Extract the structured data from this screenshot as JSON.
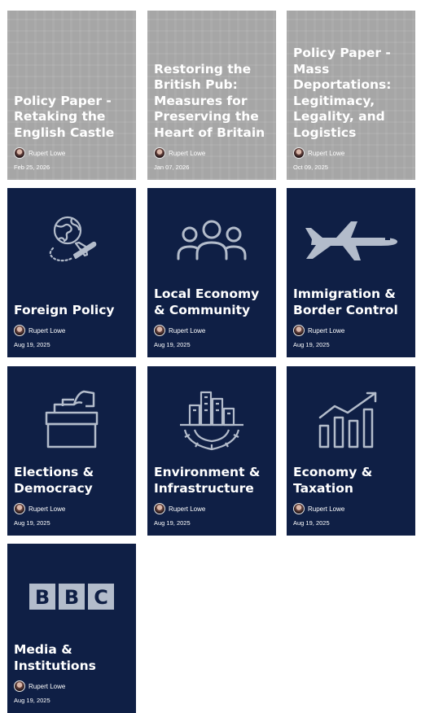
{
  "cards": [
    {
      "title": "Policy Paper - Retaking the English Castle",
      "author": "Rupert Lowe",
      "date": "Feb 25, 2026"
    },
    {
      "title": "Restoring the British Pub: Measures for Preserving the Heart of Britain",
      "author": "Rupert Lowe",
      "date": "Jan 07, 2026"
    },
    {
      "title": "Policy Paper - Mass Deportations: Legitimacy, Legality, and Logistics",
      "author": "Rupert Lowe",
      "date": "Oct 09, 2025"
    },
    {
      "title": "Foreign Policy",
      "author": "Rupert Lowe",
      "date": "Aug 19, 2025",
      "icon": "globe-plane-icon"
    },
    {
      "title": "Local Economy & Community",
      "author": "Rupert Lowe",
      "date": "Aug 19, 2025",
      "icon": "people-icon"
    },
    {
      "title": "Immigration & Border Control",
      "author": "Rupert Lowe",
      "date": "Aug 19, 2025",
      "icon": "airplane-icon"
    },
    {
      "title": "Elections & Democracy",
      "author": "Rupert Lowe",
      "date": "Aug 19, 2025",
      "icon": "ballot-box-icon"
    },
    {
      "title": "Environment & Infrastructure",
      "author": "Rupert Lowe",
      "date": "Aug 19, 2025",
      "icon": "city-gear-icon"
    },
    {
      "title": "Economy & Taxation",
      "author": "Rupert Lowe",
      "date": "Aug 19, 2025",
      "icon": "growth-chart-icon"
    },
    {
      "title": "Media & Institutions",
      "author": "Rupert Lowe",
      "date": "Aug 19, 2025",
      "icon": "bbc-logo-icon",
      "logo_letters": [
        "B",
        "B",
        "C"
      ]
    }
  ],
  "colors": {
    "topic_background": "#0f1f45",
    "paper_background": "#a6a6a6",
    "icon_color": "#b3bccb"
  }
}
